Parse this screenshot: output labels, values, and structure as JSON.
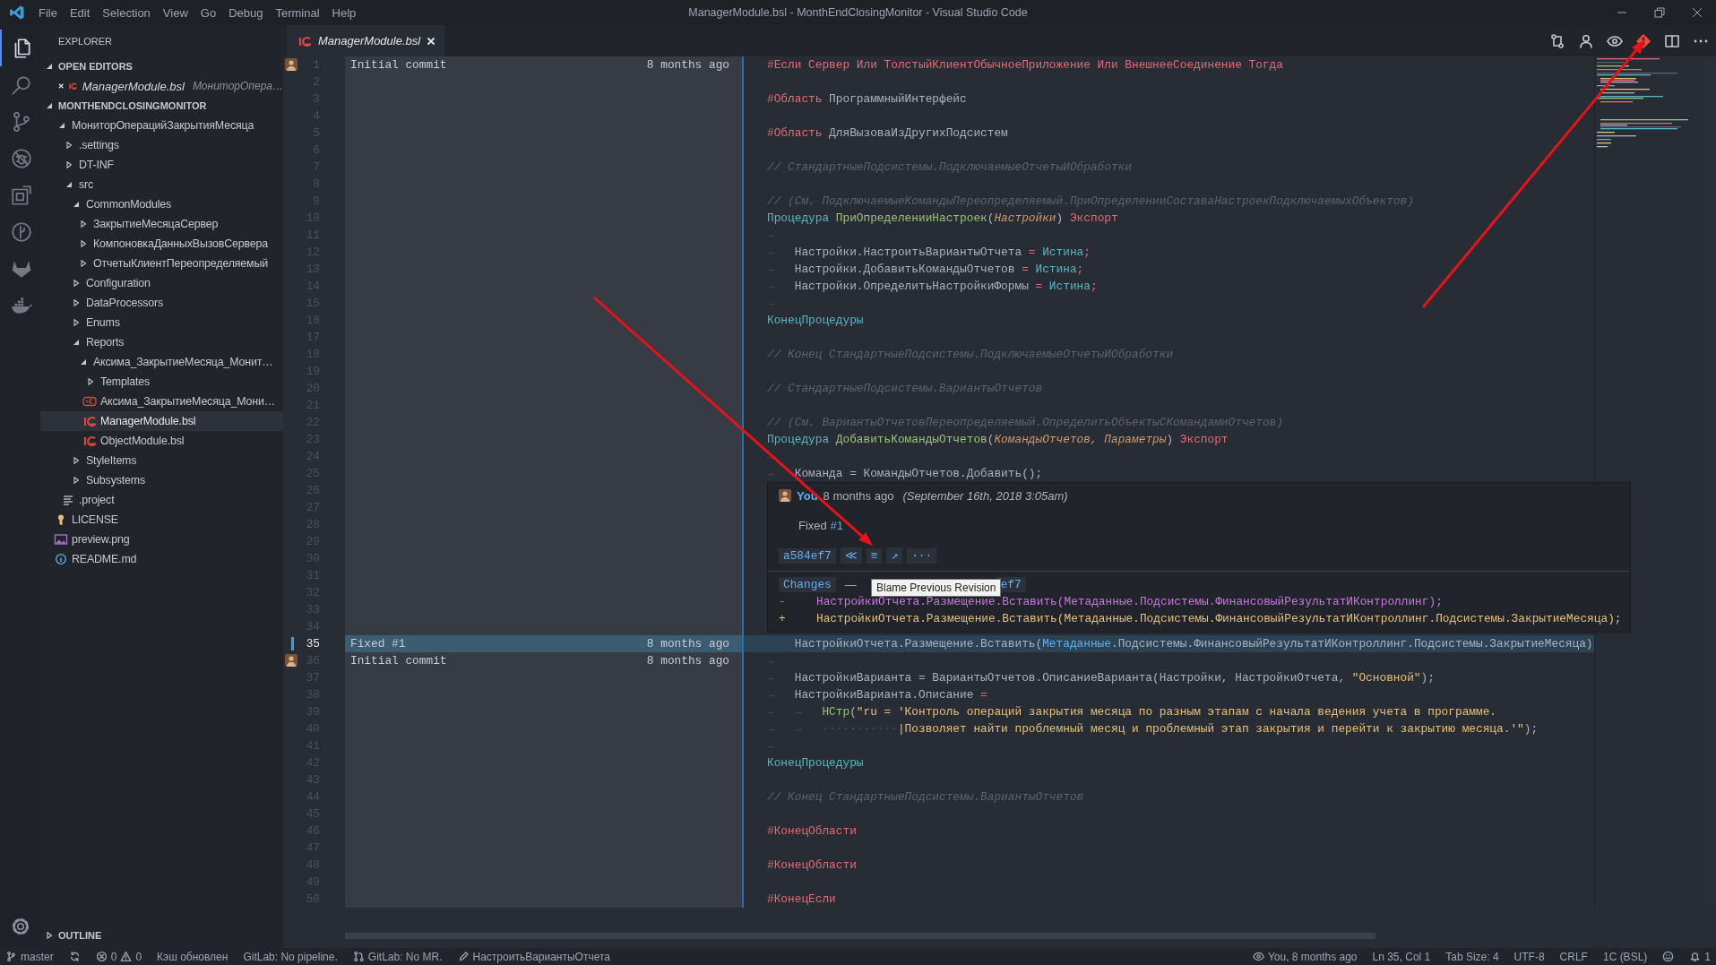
{
  "titlebar": {
    "menu": [
      "File",
      "Edit",
      "Selection",
      "View",
      "Go",
      "Debug",
      "Terminal",
      "Help"
    ],
    "title": "ManagerModule.bsl - MonthEndClosingMonitor - Visual Studio Code"
  },
  "activity_bar": [
    {
      "kind": "explorer",
      "selected": true
    },
    {
      "kind": "search",
      "selected": false
    },
    {
      "kind": "scm",
      "selected": false
    },
    {
      "kind": "debug",
      "selected": false
    },
    {
      "kind": "extensions",
      "selected": false
    },
    {
      "kind": "history",
      "selected": false
    },
    {
      "kind": "gitlab",
      "selected": false
    },
    {
      "kind": "docker",
      "selected": false
    }
  ],
  "sidebar": {
    "title": "EXPLORER",
    "open_editors": {
      "title": "OPEN EDITORS",
      "expanded": true,
      "items": [
        {
          "name": "ManagerModule.bsl",
          "path": "МониторОпера…",
          "kind": "bsl",
          "selected": false
        }
      ]
    },
    "folder": {
      "title": "MONTHENDCLOSINGMONITOR",
      "expanded": true,
      "items": [
        {
          "name": "МониторОперацийЗакрытияМесяца",
          "kind": "folder",
          "expanded": true,
          "selected": false,
          "children": [
            {
              "name": ".settings",
              "kind": "folder",
              "expanded": false,
              "selected": false
            },
            {
              "name": "DT-INF",
              "kind": "folder",
              "expanded": false,
              "selected": false
            },
            {
              "name": "src",
              "kind": "folder",
              "expanded": true,
              "selected": false,
              "children": [
                {
                  "name": "CommonModules",
                  "kind": "folder",
                  "expanded": true,
                  "selected": false,
                  "children": [
                    {
                      "name": "ЗакрытиеМесяцаСервер",
                      "kind": "folder",
                      "expanded": false,
                      "selected": false
                    },
                    {
                      "name": "КомпоновкаДанныхВызовСервера",
                      "kind": "folder",
                      "expanded": false,
                      "selected": false
                    },
                    {
                      "name": "ОтчетыКлиентПереопределяемый",
                      "kind": "folder",
                      "expanded": false,
                      "selected": false
                    }
                  ]
                },
                {
                  "name": "Configuration",
                  "kind": "folder",
                  "expanded": false,
                  "selected": false
                },
                {
                  "name": "DataProcessors",
                  "kind": "folder",
                  "expanded": false,
                  "selected": false
                },
                {
                  "name": "Enums",
                  "kind": "folder",
                  "expanded": false,
                  "selected": false
                },
                {
                  "name": "Reports",
                  "kind": "folder",
                  "expanded": true,
                  "selected": false,
                  "children": [
                    {
                      "name": "Аксима_ЗакрытиеМесяца_Монит…",
                      "kind": "folder",
                      "expanded": true,
                      "selected": false,
                      "children": [
                        {
                          "name": "Templates",
                          "kind": "folder",
                          "expanded": false,
                          "selected": false
                        },
                        {
                          "name": "Аксима_ЗакрытиеМесяца_Мони…",
                          "kind": "form",
                          "selected": false
                        },
                        {
                          "name": "ManagerModule.bsl",
                          "kind": "bsl",
                          "selected": true
                        },
                        {
                          "name": "ObjectModule.bsl",
                          "kind": "bsl",
                          "selected": false
                        }
                      ]
                    }
                  ]
                },
                {
                  "name": "StyleItems",
                  "kind": "folder",
                  "expanded": false,
                  "selected": false
                },
                {
                  "name": "Subsystems",
                  "kind": "folder",
                  "expanded": false,
                  "selected": false
                }
              ]
            },
            {
              "name": ".project",
              "kind": "lines",
              "selected": false
            }
          ]
        },
        {
          "name": "LICENSE",
          "kind": "license",
          "selected": false
        },
        {
          "name": "preview.png",
          "kind": "image",
          "selected": false
        },
        {
          "name": "README.md",
          "kind": "info",
          "selected": false
        }
      ]
    },
    "outline": {
      "title": "OUTLINE",
      "expanded": false
    }
  },
  "editor": {
    "tab": {
      "label": "ManagerModule.bsl",
      "kind": "bsl",
      "selected": true
    },
    "lines": [
      {
        "number": "1",
        "current": false,
        "blame": {
          "message": "Initial commit",
          "age": "8 months ago",
          "avatar": true
        },
        "code": [
          {
            "kind": "pre",
            "text": "#Если Сервер Или ТолстыйКлиентОбычноеПриложение Или ВнешнееСоединение Тогда"
          }
        ]
      },
      {
        "number": "2",
        "current": false
      },
      {
        "number": "3",
        "current": false,
        "code": [
          {
            "kind": "pre",
            "text": "#Область"
          },
          {
            "kind": "plain",
            "text": " ПрограммныйИнтерфейс"
          }
        ]
      },
      {
        "number": "4",
        "current": false
      },
      {
        "number": "5",
        "current": false,
        "code": [
          {
            "kind": "pre",
            "text": "#Область"
          },
          {
            "kind": "plain",
            "text": " ДляВызоваИзДругихПодсистем"
          }
        ]
      },
      {
        "number": "6",
        "current": false
      },
      {
        "number": "7",
        "current": false,
        "code": [
          {
            "kind": "comment",
            "text": "// СтандартныеПодсистемы.ПодключаемыеОтчетыИОбработки"
          }
        ]
      },
      {
        "number": "8",
        "current": false
      },
      {
        "number": "9",
        "current": false,
        "code": [
          {
            "kind": "comment",
            "text": "// (См. ПодключаемыеКомандыПереопределяемый.ПриОпределенииСоставаНастроекПодключаемыхОбъектов)"
          }
        ]
      },
      {
        "number": "10",
        "current": false,
        "code": [
          {
            "kind": "kw",
            "text": "Процедура "
          },
          {
            "kind": "func",
            "text": "ПриОпределенииНастроек"
          },
          {
            "kind": "plain",
            "text": "("
          },
          {
            "kind": "param",
            "text": "Настройки"
          },
          {
            "kind": "plain",
            "text": ") "
          },
          {
            "kind": "export",
            "text": "Экспорт"
          }
        ]
      },
      {
        "number": "11",
        "current": false,
        "code": [
          {
            "kind": "ws",
            "text": "→"
          }
        ]
      },
      {
        "number": "12",
        "current": false,
        "code": [
          {
            "kind": "ws",
            "text": "→   "
          },
          {
            "kind": "plain",
            "text": "Настройки.НастроитьВариантыОтчета "
          },
          {
            "kind": "op",
            "text": "="
          },
          {
            "kind": "const",
            "text": " Истина"
          },
          {
            "kind": "op",
            "text": ";"
          }
        ]
      },
      {
        "number": "13",
        "current": false,
        "code": [
          {
            "kind": "ws",
            "text": "→   "
          },
          {
            "kind": "plain",
            "text": "Настройки.ДобавитьКомандыОтчетов "
          },
          {
            "kind": "op",
            "text": "="
          },
          {
            "kind": "const",
            "text": " Истина"
          },
          {
            "kind": "op",
            "text": ";"
          }
        ]
      },
      {
        "number": "14",
        "current": false,
        "code": [
          {
            "kind": "ws",
            "text": "→   "
          },
          {
            "kind": "plain",
            "text": "Настройки.ОпределитьНастройкиФормы "
          },
          {
            "kind": "op",
            "text": "="
          },
          {
            "kind": "const",
            "text": " Истина"
          },
          {
            "kind": "op",
            "text": ";"
          }
        ]
      },
      {
        "number": "15",
        "current": false,
        "code": [
          {
            "kind": "ws",
            "text": "→"
          }
        ]
      },
      {
        "number": "16",
        "current": false,
        "code": [
          {
            "kind": "kw",
            "text": "КонецПроцедуры"
          }
        ]
      },
      {
        "number": "17",
        "current": false
      },
      {
        "number": "18",
        "current": false,
        "code": [
          {
            "kind": "comment",
            "text": "// Конец СтандартныеПодсистемы.ПодключаемыеОтчетыИОбработки"
          }
        ]
      },
      {
        "number": "19",
        "current": false
      },
      {
        "number": "20",
        "current": false,
        "code": [
          {
            "kind": "comment",
            "text": "// СтандартныеПодсистемы.ВариантыОтчетов"
          }
        ]
      },
      {
        "number": "21",
        "current": false
      },
      {
        "number": "22",
        "current": false,
        "code": [
          {
            "kind": "comment",
            "text": "// (См. ВариантыОтчетовПереопределяемый.ОпределитьОбъектыСКомандамиОтчетов)"
          }
        ]
      },
      {
        "number": "23",
        "current": false,
        "code": [
          {
            "kind": "kw",
            "text": "Процедура "
          },
          {
            "kind": "func",
            "text": "ДобавитьКомандыОтчетов"
          },
          {
            "kind": "plain",
            "text": "("
          },
          {
            "kind": "param",
            "text": "КомандыОтчетов, Параметры"
          },
          {
            "kind": "plain",
            "text": ") "
          },
          {
            "kind": "export",
            "text": "Экспорт"
          }
        ]
      },
      {
        "number": "24",
        "current": false,
        "code": [
          {
            "kind": "ws",
            "text": "→"
          }
        ]
      },
      {
        "number": "25",
        "current": false,
        "code": [
          {
            "kind": "ws",
            "text": "→   "
          },
          {
            "kind": "plain",
            "text": "Команда = КомандыОтчетов.Добавить();"
          }
        ]
      },
      {
        "number": "26",
        "current": false
      },
      {
        "number": "27",
        "current": false
      },
      {
        "number": "28",
        "current": false
      },
      {
        "number": "29",
        "current": false
      },
      {
        "number": "30",
        "current": false
      },
      {
        "number": "31",
        "current": false
      },
      {
        "number": "32",
        "current": false
      },
      {
        "number": "33",
        "current": false
      },
      {
        "number": "34",
        "current": false
      },
      {
        "number": "35",
        "current": true,
        "blame": {
          "message": "Fixed #1",
          "age": "8 months ago",
          "avatar": false
        },
        "code": [
          {
            "kind": "plain",
            "text": "    НастройкиОтчета.Размещение.Вставить("
          },
          {
            "kind": "meta",
            "text": "Метаданные"
          },
          {
            "kind": "plain",
            "text": ".Подсистемы.ФинансовыйРезультатИКонтроллинг.Подсистемы.ЗакрытиеМесяца)"
          }
        ]
      },
      {
        "number": "36",
        "current": false,
        "blame": {
          "message": "Initial commit",
          "age": "8 months ago",
          "avatar": true
        },
        "code": [
          {
            "kind": "ws",
            "text": "→"
          }
        ]
      },
      {
        "number": "37",
        "current": false,
        "code": [
          {
            "kind": "ws",
            "text": "→   "
          },
          {
            "kind": "plain",
            "text": "НастройкиВарианта = ВариантыОтчетов.ОписаниеВарианта(Настройки, НастройкиОтчета, "
          },
          {
            "kind": "str",
            "text": "\"Основной\""
          },
          {
            "kind": "plain",
            "text": ");"
          }
        ]
      },
      {
        "number": "38",
        "current": false,
        "code": [
          {
            "kind": "ws",
            "text": "→   "
          },
          {
            "kind": "plain",
            "text": "НастройкиВарианта.Описание "
          },
          {
            "kind": "op",
            "text": "="
          }
        ]
      },
      {
        "number": "39",
        "current": false,
        "code": [
          {
            "kind": "ws",
            "text": "→   →   "
          },
          {
            "kind": "func",
            "text": "НСтр"
          },
          {
            "kind": "plain",
            "text": "("
          },
          {
            "kind": "str",
            "text": "\"ru = 'Контроль операций закрытия месяца по разным этапам с начала ведения учета в программе."
          }
        ]
      },
      {
        "number": "40",
        "current": false,
        "code": [
          {
            "kind": "ws",
            "text": "→   →   ···········"
          },
          {
            "kind": "str",
            "text": "|Позволяет найти проблемный месяц и проблемный этап закрытия и перейти к закрытию месяца.'\""
          },
          {
            "kind": "plain",
            "text": ");"
          }
        ]
      },
      {
        "number": "41",
        "current": false,
        "code": [
          {
            "kind": "ws",
            "text": "→"
          }
        ]
      },
      {
        "number": "42",
        "current": false,
        "code": [
          {
            "kind": "kw",
            "text": "КонецПроцедуры"
          }
        ]
      },
      {
        "number": "43",
        "current": false
      },
      {
        "number": "44",
        "current": false,
        "code": [
          {
            "kind": "comment",
            "text": "// Конец СтандартныеПодсистемы.ВариантыОтчетов"
          }
        ]
      },
      {
        "number": "45",
        "current": false
      },
      {
        "number": "46",
        "current": false,
        "code": [
          {
            "kind": "pre",
            "text": "#КонецОбласти"
          }
        ]
      },
      {
        "number": "47",
        "current": false
      },
      {
        "number": "48",
        "current": false,
        "code": [
          {
            "kind": "pre",
            "text": "#КонецОбласти"
          }
        ]
      },
      {
        "number": "49",
        "current": false
      },
      {
        "number": "50",
        "current": false,
        "code": [
          {
            "kind": "pre",
            "text": "#КонецЕсли"
          }
        ]
      }
    ],
    "blame_hover": {
      "author": "You",
      "age": "8 months ago",
      "date": "(September 16th, 2018 3:05am)",
      "message": "Fixed ",
      "message_link": "#1",
      "commit": "a584ef7",
      "actions": [
        "≪",
        "≡",
        "↗",
        "···"
      ],
      "changes_label": "Changes",
      "separator": "—",
      "compare_commit": "ef7",
      "diff": [
        {
          "kind": "removed",
          "sign": "-",
          "text": "НастройкиОтчета.Размещение.Вставить(Метаданные.Подсистемы.ФинансовыйРезультатИКонтроллинг);"
        },
        {
          "kind": "added",
          "sign": "+",
          "text": "НастройкиОтчета.Размещение.Вставить(Метаданные.Подсистемы.ФинансовыйРезультатИКонтроллинг.Подсистемы.ЗакрытиеМесяца);"
        }
      ],
      "tooltip": "Blame Previous Revision"
    }
  },
  "status_bar": {
    "left": [
      {
        "kind": "branch",
        "text": "master"
      },
      {
        "kind": "sync"
      },
      {
        "kind": "problems",
        "errors": "0",
        "warnings": "0"
      },
      {
        "kind": "text",
        "text": "Кэш обновлен"
      },
      {
        "kind": "text",
        "text": "GitLab: No pipeline."
      },
      {
        "kind": "merge",
        "text": "GitLab: No MR."
      },
      {
        "kind": "pencil",
        "text": "НастроитьВариантыОтчета"
      }
    ],
    "right": [
      {
        "kind": "eye",
        "text": "You, 8 months ago"
      },
      {
        "kind": "text",
        "text": "Ln 35, Col 1"
      },
      {
        "kind": "text",
        "text": "Tab Size: 4"
      },
      {
        "kind": "text",
        "text": "UTF-8"
      },
      {
        "kind": "text",
        "text": "CRLF"
      },
      {
        "kind": "text",
        "text": "1C (BSL)"
      },
      {
        "kind": "smiley"
      },
      {
        "kind": "bell",
        "text": "1"
      }
    ]
  }
}
